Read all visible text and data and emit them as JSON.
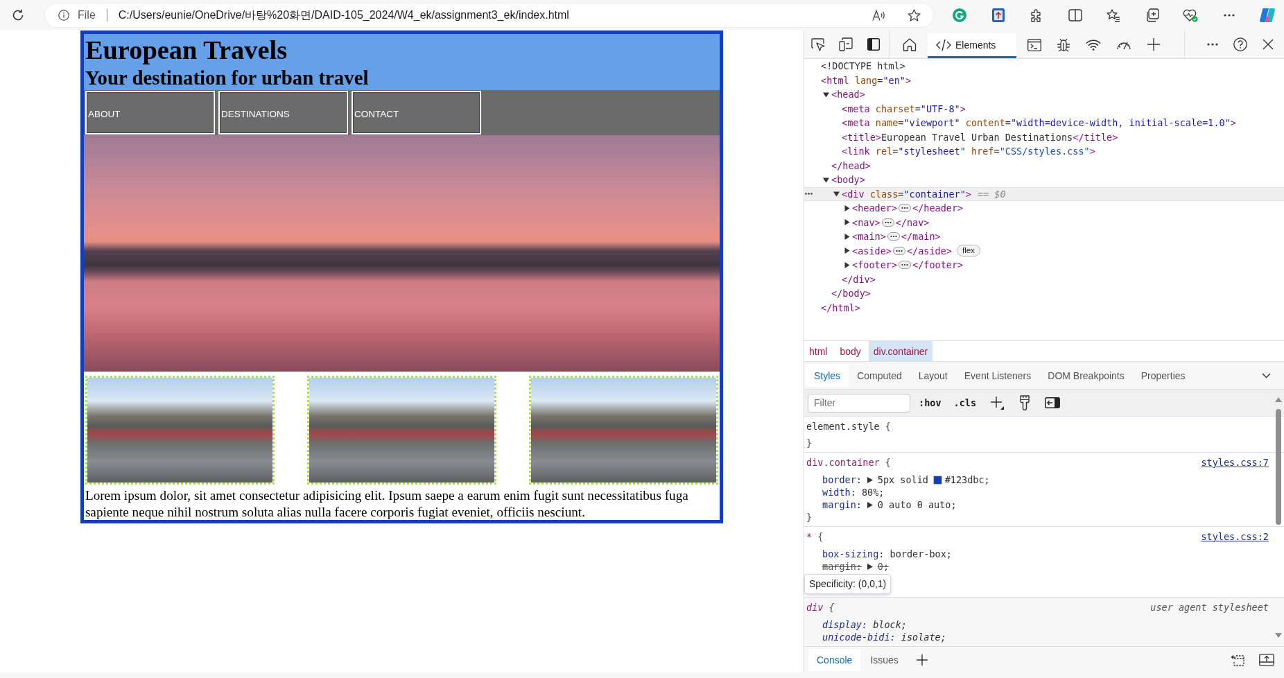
{
  "browser": {
    "address_bar": {
      "label": "File",
      "value": "C:/Users/eunie/OneDrive/바탕%20화면/DAID-105_2024/W4_ek/assignment3_ek/index.html"
    }
  },
  "page": {
    "title": "European Travels",
    "subtitle": "Your destination for urban travel",
    "nav": [
      {
        "label": "ABOUT"
      },
      {
        "label": "DESTINATIONS"
      },
      {
        "label": "CONTACT"
      }
    ],
    "hero": {
      "kind": "photo"
    },
    "gallery": [
      {
        "kind": "photo"
      },
      {
        "kind": "photo"
      },
      {
        "kind": "photo"
      }
    ],
    "paragraph": "Lorem ipsum dolor, sit amet consectetur adipisicing elit. Ipsum saepe a earum enim fugit sunt necessitatibus fuga sapiente neque nihil nostrum soluta alias nulla facere corporis fugiat eveniet, officiis nesciunt."
  },
  "devtools": {
    "tabs": [
      {
        "kind": "welcome",
        "selected": false
      },
      {
        "kind": "elements",
        "label": "Elements",
        "selected": true
      },
      {
        "kind": "console",
        "selected": false
      },
      {
        "kind": "sources",
        "selected": false
      },
      {
        "kind": "network",
        "selected": false
      },
      {
        "kind": "performance",
        "selected": false
      }
    ],
    "dom_tree": [
      {
        "open": [
          {
            "kind": "plain",
            "text": "<!DOCTYPE html>"
          }
        ],
        "selected": false
      },
      {
        "open": [
          {
            "kind": "tag",
            "text": "<html"
          },
          {
            "kind": "attr",
            "text": " lang"
          },
          {
            "kind": "plain",
            "text": "="
          },
          {
            "kind": "value",
            "text": "\"en\""
          },
          {
            "kind": "tag",
            "text": ">"
          }
        ],
        "selected": false,
        "children": [
          {
            "open": [
              {
                "kind": "tag",
                "text": "<head>"
              }
            ],
            "close": [
              {
                "kind": "tag",
                "text": "</head>"
              }
            ],
            "expanded": true,
            "selected": false,
            "children": [
              {
                "open": [
                  {
                    "kind": "tag",
                    "text": "<meta"
                  },
                  {
                    "kind": "attr",
                    "text": " charset"
                  },
                  {
                    "kind": "plain",
                    "text": "="
                  },
                  {
                    "kind": "value",
                    "text": "\"UTF-8\""
                  },
                  {
                    "kind": "tag",
                    "text": ">"
                  }
                ],
                "selected": false
              },
              {
                "open": [
                  {
                    "kind": "tag",
                    "text": "<meta"
                  },
                  {
                    "kind": "attr",
                    "text": " name"
                  },
                  {
                    "kind": "plain",
                    "text": "="
                  },
                  {
                    "kind": "value",
                    "text": "\"viewport\""
                  },
                  {
                    "kind": "attr",
                    "text": " content"
                  },
                  {
                    "kind": "plain",
                    "text": "="
                  },
                  {
                    "kind": "value",
                    "text": "\"width=device-width, initial-scale=1.0\""
                  },
                  {
                    "kind": "tag",
                    "text": ">"
                  }
                ],
                "selected": false
              },
              {
                "open": [
                  {
                    "kind": "tag",
                    "text": "<title>"
                  },
                  {
                    "kind": "plain",
                    "text": "European Travel Urban Destinations"
                  },
                  {
                    "kind": "tag",
                    "text": "</title>"
                  }
                ],
                "selected": false
              },
              {
                "open": [
                  {
                    "kind": "tag",
                    "text": "<link"
                  },
                  {
                    "kind": "attr",
                    "text": " rel"
                  },
                  {
                    "kind": "plain",
                    "text": "="
                  },
                  {
                    "kind": "value",
                    "text": "\"stylesheet\""
                  },
                  {
                    "kind": "attr",
                    "text": " href"
                  },
                  {
                    "kind": "plain",
                    "text": "="
                  },
                  {
                    "kind": "link",
                    "text": "\"CSS/styles.css\""
                  },
                  {
                    "kind": "tag",
                    "text": ">"
                  }
                ],
                "selected": false
              }
            ]
          },
          {
            "open": [
              {
                "kind": "tag",
                "text": "<body>"
              }
            ],
            "close": [
              {
                "kind": "tag",
                "text": "</body>"
              }
            ],
            "expanded": true,
            "selected": false,
            "children": [
              {
                "open": [
                  {
                    "kind": "tag",
                    "text": "<div"
                  },
                  {
                    "kind": "attr",
                    "text": " class"
                  },
                  {
                    "kind": "plain",
                    "text": "="
                  },
                  {
                    "kind": "value",
                    "text": "\"container\""
                  },
                  {
                    "kind": "tag",
                    "text": ">"
                  }
                ],
                "ref": "== $0",
                "close": [
                  {
                    "kind": "tag",
                    "text": "</div>"
                  }
                ],
                "expanded": true,
                "selected": true,
                "children": [
                  {
                    "open": [
                      {
                        "kind": "tag",
                        "text": "<header>"
                      }
                    ],
                    "close": [
                      {
                        "kind": "tag",
                        "text": "</header>"
                      }
                    ],
                    "expanded": false,
                    "selected": false
                  },
                  {
                    "open": [
                      {
                        "kind": "tag",
                        "text": "<nav>"
                      }
                    ],
                    "close": [
                      {
                        "kind": "tag",
                        "text": "</nav>"
                      }
                    ],
                    "expanded": false,
                    "selected": false
                  },
                  {
                    "open": [
                      {
                        "kind": "tag",
                        "text": "<main>"
                      }
                    ],
                    "close": [
                      {
                        "kind": "tag",
                        "text": "</main>"
                      }
                    ],
                    "expanded": false,
                    "selected": false
                  },
                  {
                    "open": [
                      {
                        "kind": "tag",
                        "text": "<aside>"
                      }
                    ],
                    "close": [
                      {
                        "kind": "tag",
                        "text": "</aside>"
                      }
                    ],
                    "expanded": false,
                    "selected": false,
                    "badge": "flex"
                  },
                  {
                    "open": [
                      {
                        "kind": "tag",
                        "text": "<footer>"
                      }
                    ],
                    "close": [
                      {
                        "kind": "tag",
                        "text": "</footer>"
                      }
                    ],
                    "expanded": false,
                    "selected": false
                  }
                ]
              }
            ]
          }
        ],
        "close": [
          {
            "kind": "tag",
            "text": "</html>"
          }
        ]
      }
    ],
    "breadcrumbs": [
      {
        "label": "html",
        "selected": false
      },
      {
        "label": "body",
        "selected": false
      },
      {
        "label": "div.container",
        "selected": true
      }
    ],
    "panes": [
      {
        "label": "Styles",
        "selected": true
      },
      {
        "label": "Computed",
        "selected": false
      },
      {
        "label": "Layout",
        "selected": false
      },
      {
        "label": "Event Listeners",
        "selected": false
      },
      {
        "label": "DOM Breakpoints",
        "selected": false
      },
      {
        "label": "Properties",
        "selected": false
      }
    ],
    "styles": {
      "filter": {
        "placeholder": "Filter"
      },
      "toggles": [
        ":hov",
        ".cls"
      ],
      "rules": [
        {
          "kind": "inline",
          "selector": "element.style",
          "brace_open": "{",
          "brace_close": "}"
        },
        {
          "kind": "author",
          "selector": "div.container",
          "brace_open": "{",
          "source": "styles.css:7",
          "declarations": [
            {
              "name": "border:",
              "expandable": true,
              "value": "5px solid",
              "color": "#123dbc",
              "color_value": "#123dbc;",
              "overridden": false
            },
            {
              "name": "width:",
              "expandable": false,
              "value": "80%;",
              "overridden": false
            },
            {
              "name": "margin:",
              "expandable": true,
              "value": "0 auto 0 auto;",
              "overridden": false
            }
          ],
          "brace_close": "}"
        },
        {
          "kind": "author",
          "selector": "*",
          "brace_open": "{",
          "source": "styles.css:2",
          "declarations": [
            {
              "name": "box-sizing:",
              "expandable": false,
              "value": "border-box;",
              "overridden": false
            },
            {
              "name": "margin:",
              "expandable": true,
              "value": "0;",
              "overridden": true
            }
          ],
          "tooltip": "Specificity: (0,0,1)"
        },
        {
          "kind": "user-agent",
          "selector": "div",
          "brace_open": "{",
          "source": "user agent stylesheet",
          "declarations": [
            {
              "name": "display:",
              "expandable": false,
              "value": "block;",
              "overridden": false
            },
            {
              "name": "unicode-bidi:",
              "expandable": false,
              "value": "isolate;",
              "overridden": false
            }
          ]
        }
      ]
    },
    "drawer": {
      "tabs": [
        {
          "label": "Console",
          "selected": true
        },
        {
          "label": "Issues",
          "selected": false
        }
      ]
    }
  }
}
